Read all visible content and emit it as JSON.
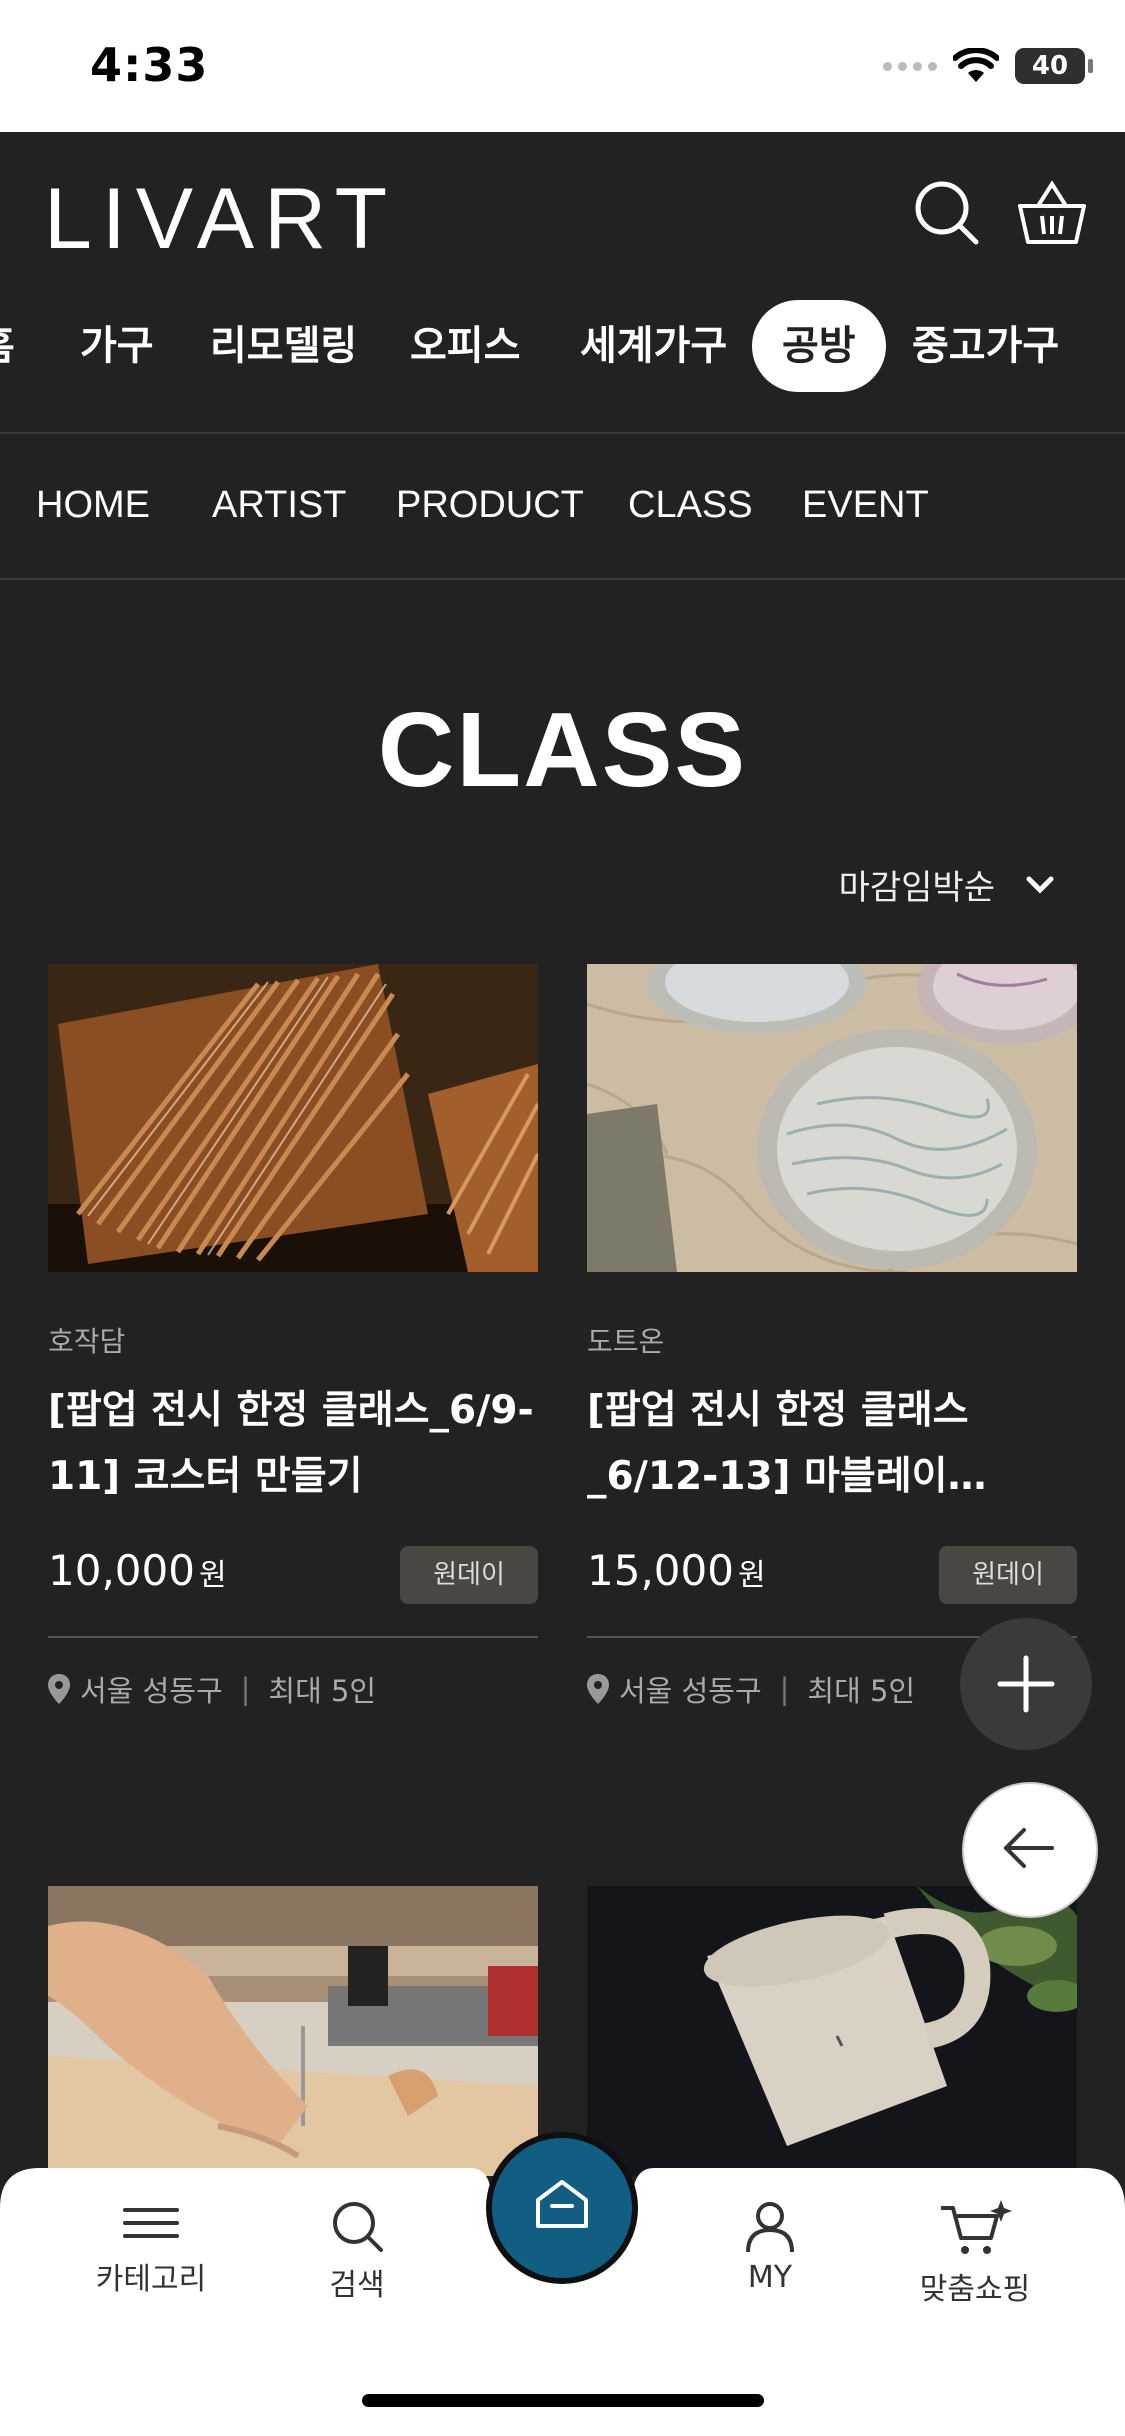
{
  "status_bar": {
    "time": "4:33",
    "battery": "40"
  },
  "header": {
    "logo": "LIVART"
  },
  "categories": [
    "홈",
    "가구",
    "리모델링",
    "오피스",
    "세계가구",
    "공방",
    "중고가구"
  ],
  "active_category": "공방",
  "subnav": [
    "HOME",
    "ARTIST",
    "PRODUCT",
    "CLASS",
    "EVENT"
  ],
  "page_title": "CLASS",
  "sort": {
    "label": "마감임박순"
  },
  "cards": [
    {
      "brand": "호작담",
      "title": "[팝업 전시 한정 클래스_6/9-11] 코스터 만들기",
      "price": "10,000",
      "currency": "원",
      "badge": "원데이",
      "location": "서울 성동구",
      "capacity": "최대 5인"
    },
    {
      "brand": "도트온",
      "title": "[팝업 전시 한정 클래스_6/12-13] 마블레이…",
      "price": "15,000",
      "currency": "원",
      "badge": "원데이",
      "location": "서울 성동구",
      "capacity": "최대 5인"
    }
  ],
  "bottom_nav": {
    "category": "카테고리",
    "search": "검색",
    "my": "MY",
    "custom_shopping": "맞춤쇼핑"
  },
  "colors": {
    "background": "#222222",
    "home_button": "#125e82"
  }
}
